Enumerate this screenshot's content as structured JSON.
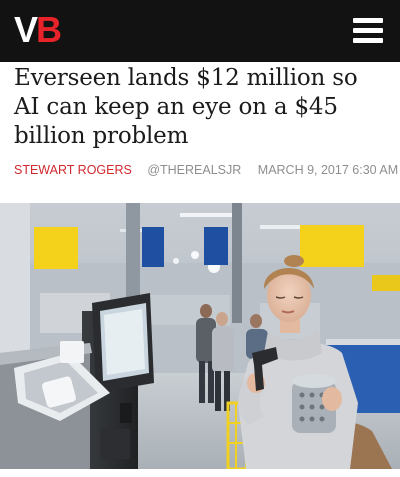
{
  "header": {
    "logo_v": "V",
    "logo_b": "B",
    "menu_icon": "hamburger-menu-icon"
  },
  "article": {
    "title": "Everseen lands $12 million so AI can keep an eye on a $45 billion problem",
    "author": "STEWART ROGERS",
    "handle": "@THEREALSJR",
    "date": "MARCH 9, 2017 6:30 AM"
  },
  "colors": {
    "topbar": "#121212",
    "brand_red": "#e8232a",
    "author_red": "#d0292e",
    "meta_gray": "#8e8e8e",
    "store_yellow": "#f4d21b",
    "store_blue": "#1f4fa0"
  }
}
